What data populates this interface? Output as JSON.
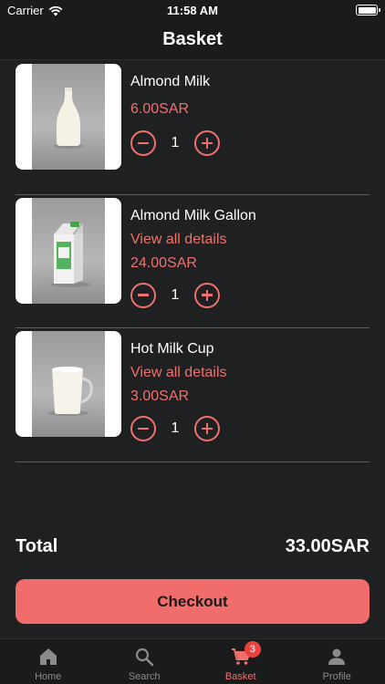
{
  "status_bar": {
    "carrier": "Carrier",
    "time": "11:58 AM",
    "battery_level": 1.0
  },
  "nav": {
    "title": "Basket"
  },
  "basket": {
    "items": [
      {
        "name": "Almond Milk",
        "details_link": "",
        "price": "6.00SAR",
        "quantity": "1",
        "image_icon": "milk-bottle-icon"
      },
      {
        "name": "Almond Milk Gallon",
        "details_link": "View all details",
        "price": "24.00SAR",
        "quantity": "1",
        "image_icon": "milk-carton-icon"
      },
      {
        "name": "Hot Milk Cup",
        "details_link": "View all details",
        "price": "3.00SAR",
        "quantity": "1",
        "image_icon": "milk-cup-icon"
      }
    ]
  },
  "summary": {
    "total_label": "Total",
    "total_value": "33.00SAR",
    "checkout_label": "Checkout"
  },
  "tab_bar": {
    "tabs": [
      {
        "label": "Home",
        "icon": "home-icon"
      },
      {
        "label": "Search",
        "icon": "search-icon"
      },
      {
        "label": "Basket",
        "icon": "cart-icon",
        "badge": "3"
      },
      {
        "label": "Profile",
        "icon": "profile-icon"
      }
    ],
    "active": "Basket"
  },
  "colors": {
    "accent": "#f0706c",
    "background": "#1f2022",
    "badge": "#e8433d"
  }
}
